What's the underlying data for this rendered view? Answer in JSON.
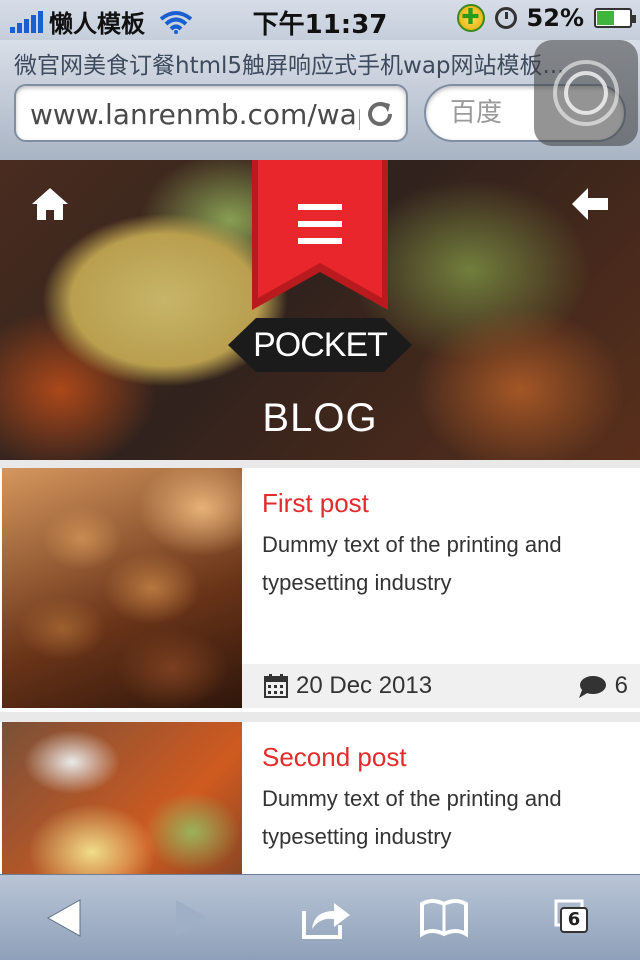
{
  "status_bar": {
    "carrier": "懒人模板",
    "time": "下午11:37",
    "battery": "52%",
    "battery_level": 0.52
  },
  "browser": {
    "page_title": "微官网美食订餐html5触屏响应式手机wap网站模板...",
    "url": "www.lanrenmb.com/wap",
    "search_placeholder": "百度",
    "tab_count": "6"
  },
  "hero": {
    "logo": "POCKET",
    "title": "BLOG"
  },
  "posts": [
    {
      "title": "First post",
      "excerpt": "Dummy text of the printing and typesetting industry",
      "date": "20 Dec 2013",
      "comments": "6"
    },
    {
      "title": "Second post",
      "excerpt": "Dummy text of the printing and typesetting industry"
    }
  ],
  "colors": {
    "accent": "#e22b2b",
    "ribbon": "#e8262b"
  },
  "icons": {
    "home": "home-icon",
    "back": "arrow-left-icon",
    "menu": "hamburger-icon",
    "calendar": "calendar-icon",
    "comment": "comment-icon"
  }
}
